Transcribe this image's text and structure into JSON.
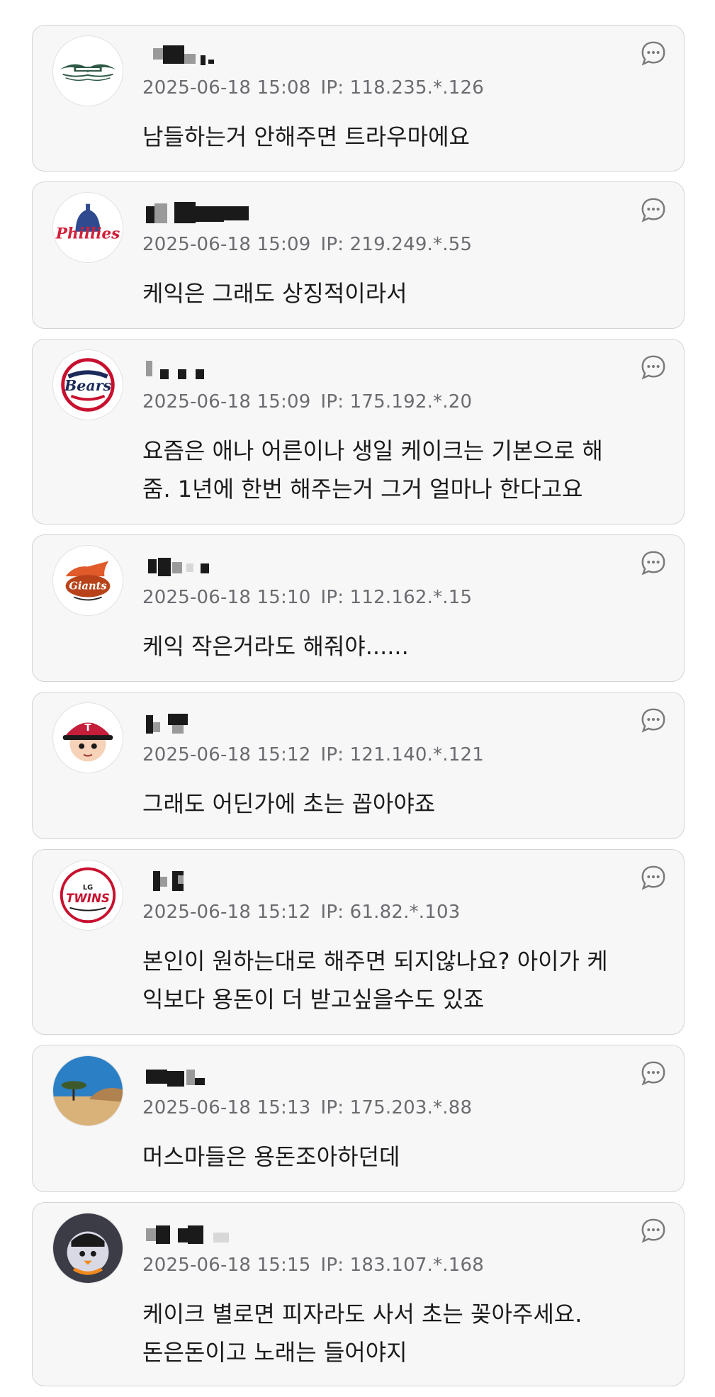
{
  "comments": [
    {
      "avatar": "aston-martin-logo",
      "datetime": "2025-06-18 15:08",
      "ip": "IP: 118.235.*.126",
      "text": "남들하는거 안해주면 트라우마에요"
    },
    {
      "avatar": "phillies-logo",
      "datetime": "2025-06-18 15:09",
      "ip": "IP: 219.249.*.55",
      "text": "케익은 그래도 상징적이라서"
    },
    {
      "avatar": "bears-logo",
      "datetime": "2025-06-18 15:09",
      "ip": "IP: 175.192.*.20",
      "text": "요즘은 애나 어른이나 생일 케이크는 기본으로 해\n줌. 1년에 한번 해주는거 그거 얼마나 한다고요"
    },
    {
      "avatar": "giants-logo",
      "datetime": "2025-06-18 15:10",
      "ip": "IP: 112.162.*.15",
      "text": "케익 작은거라도 해줘야......"
    },
    {
      "avatar": "twins-mascot-avatar",
      "datetime": "2025-06-18 15:12",
      "ip": "IP: 121.140.*.121",
      "text": "그래도 어딘가에 초는 꼽아야죠"
    },
    {
      "avatar": "lg-twins-logo",
      "datetime": "2025-06-18 15:12",
      "ip": "IP: 61.82.*.103",
      "text": "본인이 원하는대로 해주면 되지않나요? 아이가 케\n익보다 용돈이 더 받고싶을수도 있죠"
    },
    {
      "avatar": "desert-landscape-avatar",
      "datetime": "2025-06-18 15:13",
      "ip": "IP: 175.203.*.88",
      "text": "머스마들은 용돈조아하던데"
    },
    {
      "avatar": "eagles-mascot-avatar",
      "datetime": "2025-06-18 15:15",
      "ip": "IP: 183.107.*.168",
      "text": "케이크 별로면 피자라도 사서 초는 꽂아주세요.\n돈은돈이고 노래는 들어야지"
    }
  ],
  "icons": {
    "reply": "comment-bubble-icon",
    "nickname": "pixelated-nickname"
  },
  "colors": {
    "card_bg": "#f7f7f8",
    "card_border": "#d4d4d8",
    "meta_text": "#6b6b70",
    "content_text": "#1b1b1b"
  }
}
